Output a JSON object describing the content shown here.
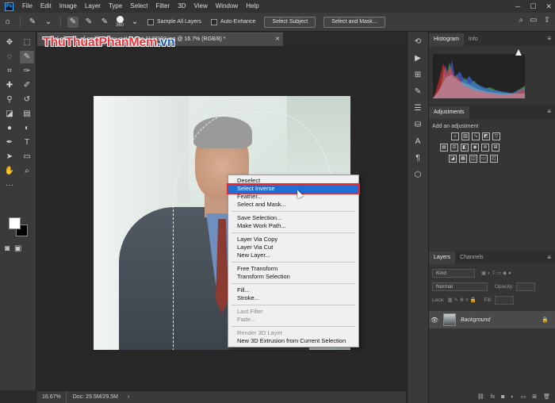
{
  "menu": [
    "File",
    "Edit",
    "Image",
    "Layer",
    "Type",
    "Select",
    "Filter",
    "3D",
    "View",
    "Window",
    "Help"
  ],
  "options": {
    "brush_size": "360",
    "sample_all_layers": "Sample All Layers",
    "auto_enhance": "Auto-Enhance",
    "select_subject": "Select Subject",
    "select_and_mask": "Select and Mask..."
  },
  "document": {
    "tab_title": "...exel-photo... of-smiling-gray-suit-jacket-1138903.jpg @ 16.7% (RGB/8) *",
    "zoom": "16.67%",
    "doc_size": "Doc: 29.5M/29.5M"
  },
  "watermark": {
    "part1": "ThuThuat",
    "part2": "PhanMem",
    "part3": ".vn"
  },
  "context_menu": {
    "groups": [
      [
        {
          "label": "Deselect"
        },
        {
          "label": "Select Inverse",
          "highlighted": true
        },
        {
          "label": "Feather..."
        },
        {
          "label": "Select and Mask..."
        }
      ],
      [
        {
          "label": "Save Selection..."
        },
        {
          "label": "Make Work Path..."
        }
      ],
      [
        {
          "label": "Layer Via Copy"
        },
        {
          "label": "Layer Via Cut"
        },
        {
          "label": "New Layer..."
        }
      ],
      [
        {
          "label": "Free Transform"
        },
        {
          "label": "Transform Selection"
        }
      ],
      [
        {
          "label": "Fill..."
        },
        {
          "label": "Stroke..."
        }
      ],
      [
        {
          "label": "Last Filter",
          "disabled": true
        },
        {
          "label": "Fade...",
          "disabled": true
        }
      ],
      [
        {
          "label": "Render 3D Layer",
          "disabled": true
        },
        {
          "label": "New 3D Extrusion from Current Selection"
        }
      ]
    ]
  },
  "panels": {
    "histogram_tab": "Histogram",
    "info_tab": "Info",
    "adjustments_title": "Adjustments",
    "add_adjustment": "Add an adjustment",
    "layers_tab": "Layers",
    "channels_tab": "Channels",
    "kind": "Kind",
    "blend_mode": "Normal",
    "opacity_label": "Opacity:",
    "lock_label": "Lock:",
    "fill_label": "Fill:",
    "layer_name": "Background"
  },
  "colors": {
    "accent": "#1f6fd6",
    "highlight_border": "#e8282f"
  }
}
